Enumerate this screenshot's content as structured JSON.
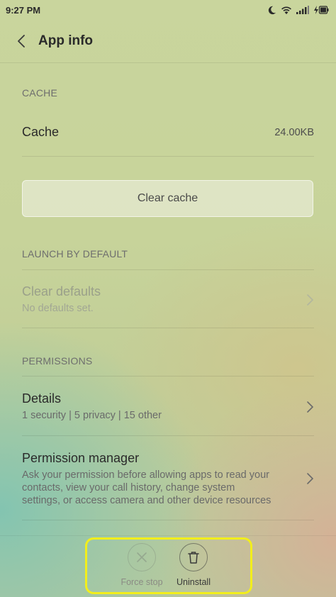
{
  "status_bar": {
    "time": "9:27 PM"
  },
  "app_bar": {
    "title": "App info"
  },
  "cache_section": {
    "header": "CACHE",
    "cache_label": "Cache",
    "cache_value": "24.00KB",
    "clear_cache_label": "Clear cache"
  },
  "launch_section": {
    "header": "LAUNCH BY DEFAULT",
    "clear_defaults_label": "Clear defaults",
    "clear_defaults_sub": "No defaults set."
  },
  "permissions_section": {
    "header": "PERMISSIONS",
    "details_label": "Details",
    "details_sub": "1 security | 5 privacy | 15 other",
    "manager_label": "Permission manager",
    "manager_sub_lines": [
      "Ask your permission before allowing apps to read your",
      "contacts, view your call history, change system",
      "settings, or access camera and other device resources"
    ]
  },
  "bottom_actions": {
    "force_stop_label": "Force stop",
    "uninstall_label": "Uninstall"
  },
  "colors": {
    "highlight": "#f2ee1c"
  }
}
